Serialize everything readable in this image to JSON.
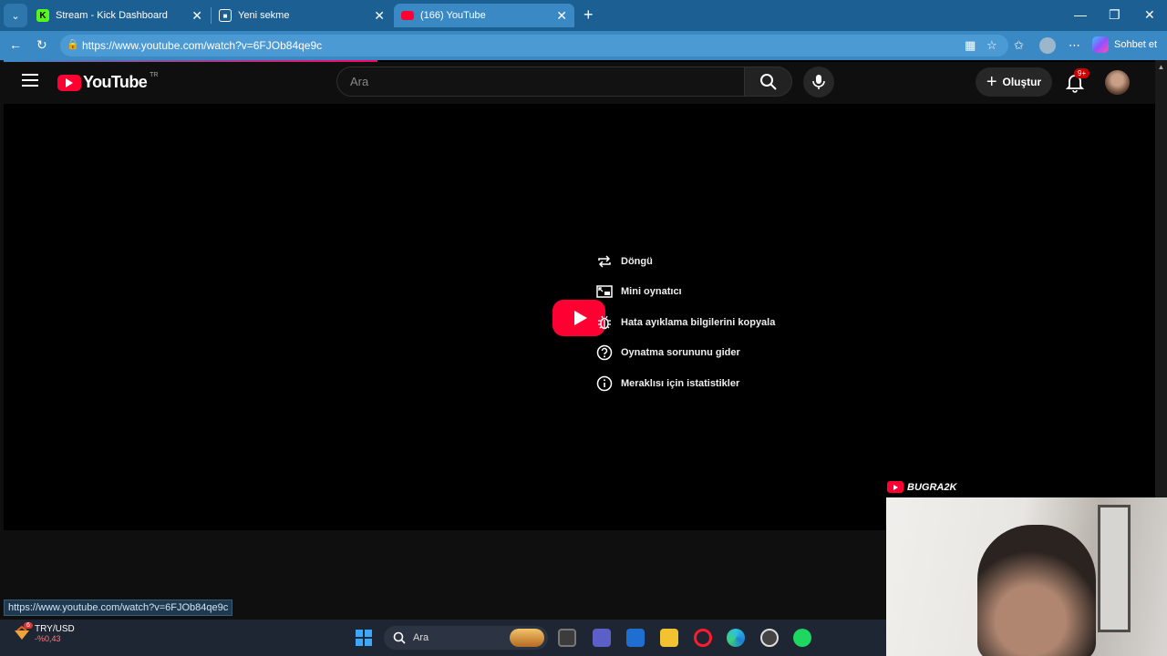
{
  "browser": {
    "tabs": [
      {
        "title": "Stream - Kick Dashboard",
        "favicon": "kick-logo-icon"
      },
      {
        "title": "Yeni sekme",
        "favicon": "new-tab-icon"
      },
      {
        "title": "(166) YouTube",
        "favicon": "youtube-logo-icon",
        "active": true
      }
    ],
    "url": "https://www.youtube.com/watch?v=6FJOb84qe9c",
    "copilot_label": "Sohbet et",
    "status_url": "https://www.youtube.com/watch?v=6FJOb84qe9c"
  },
  "youtube": {
    "logo_text": "YouTube",
    "country_code": "TR",
    "search_placeholder": "Ara",
    "create_label": "Oluştur",
    "notification_count": "9+"
  },
  "context_menu": [
    {
      "label": "Döngü",
      "icon": "loop-icon"
    },
    {
      "label": "Mini oynatıcı",
      "icon": "miniplayer-icon"
    },
    {
      "label": "Hata ayıklama bilgilerini kopyala",
      "icon": "bug-icon"
    },
    {
      "label": "Oynatma sorununu gider",
      "icon": "help-icon"
    },
    {
      "label": "Meraklısı için istatistikler",
      "icon": "info-icon"
    }
  ],
  "webcam": {
    "channel_label": "BUGRA2K"
  },
  "taskbar": {
    "weather_badge": "6",
    "currency": "TRY/USD",
    "currency_change": "-%0,43",
    "search_label": "Ara"
  },
  "colors": {
    "youtube_red": "#ff0033",
    "browser_blue": "#3a89c4"
  }
}
